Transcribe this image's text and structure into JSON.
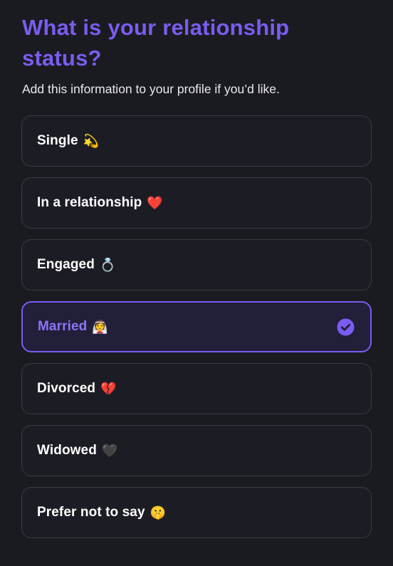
{
  "header": {
    "title": "What is your relationship status?",
    "subtitle": "Add this information to your profile if you’d like."
  },
  "options": [
    {
      "label": "Single",
      "emoji": "💫",
      "selected": false
    },
    {
      "label": "In a relationship",
      "emoji": "❤️",
      "selected": false
    },
    {
      "label": "Engaged",
      "emoji": "💍",
      "selected": false
    },
    {
      "label": "Married",
      "emoji": "👰",
      "selected": true
    },
    {
      "label": "Divorced",
      "emoji": "💔",
      "selected": false
    },
    {
      "label": "Widowed",
      "emoji": "🖤",
      "selected": false
    },
    {
      "label": "Prefer not to say",
      "emoji": "🤫",
      "selected": false
    }
  ],
  "colors": {
    "background": "#1a1b20",
    "accent": "#7b5cf0",
    "card": "#1c1d24",
    "card_border": "#393b44",
    "selected_card": "#221f3a"
  },
  "icons": {
    "selected_indicator": "check-circle-icon"
  }
}
